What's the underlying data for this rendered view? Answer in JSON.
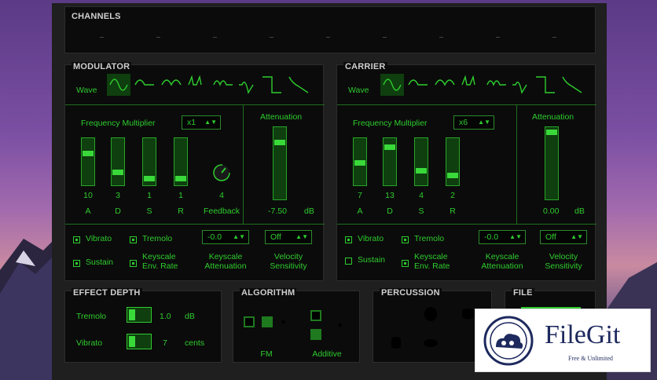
{
  "sections": {
    "channels": "CHANNELS",
    "modulator": "MODULATOR",
    "carrier": "CARRIER",
    "effect_depth": "EFFECT DEPTH",
    "algorithm": "ALGORITHM",
    "percussion": "PERCUSSION",
    "file": "FILE"
  },
  "channels": {
    "slots": [
      "-",
      "-",
      "-",
      "-",
      "-",
      "-",
      "-",
      "-",
      "-"
    ]
  },
  "modulator": {
    "wave_label": "Wave",
    "freq_label": "Frequency Multiplier",
    "freq_value": "x1",
    "atten_label": "Attenuation",
    "atten_value": "-7.50",
    "atten_unit": "dB",
    "env": [
      {
        "label": "A",
        "value": "10",
        "level": 0.67
      },
      {
        "label": "D",
        "value": "3",
        "level": 0.2
      },
      {
        "label": "S",
        "value": "1",
        "level": 0.07
      },
      {
        "label": "R",
        "value": "1",
        "level": 0.07
      }
    ],
    "feedback": {
      "label": "Feedback",
      "value": "4"
    },
    "toggles": {
      "vibrato": "Vibrato",
      "tremolo": "Tremolo",
      "sustain": "Sustain",
      "keyscale_env_rate": "Keyscale\nEnv. Rate"
    },
    "keyscale_att": {
      "label": "Keyscale\nAttenuation",
      "value": "-0.0"
    },
    "velocity": {
      "label": "Velocity\nSensitivity",
      "value": "Off"
    }
  },
  "carrier": {
    "wave_label": "Wave",
    "freq_label": "Frequency Multiplier",
    "freq_value": "x6",
    "atten_label": "Attenuation",
    "atten_value": "0.00",
    "atten_unit": "dB",
    "env": [
      {
        "label": "A",
        "value": "7",
        "level": 0.47
      },
      {
        "label": "D",
        "value": "13",
        "level": 0.87
      },
      {
        "label": "S",
        "value": "4",
        "level": 0.27
      },
      {
        "label": "R",
        "value": "2",
        "level": 0.13
      }
    ],
    "toggles": {
      "vibrato": "Vibrato",
      "tremolo": "Tremolo",
      "sustain": "Sustain",
      "keyscale_env_rate": "Keyscale\nEnv. Rate"
    },
    "keyscale_att": {
      "label": "Keyscale\nAttenuation",
      "value": "-0.0"
    },
    "velocity": {
      "label": "Velocity\nSensitivity",
      "value": "Off"
    }
  },
  "effect_depth": {
    "tremolo_label": "Tremolo",
    "tremolo_value": "1.0",
    "tremolo_unit": "dB",
    "vibrato_label": "Vibrato",
    "vibrato_value": "7",
    "vibrato_unit": "cents"
  },
  "algorithm": {
    "fm_label": "FM",
    "additive_label": "Additive"
  },
  "watermark": {
    "brand": "FileGit",
    "tagline": "Free & Unlimited"
  }
}
